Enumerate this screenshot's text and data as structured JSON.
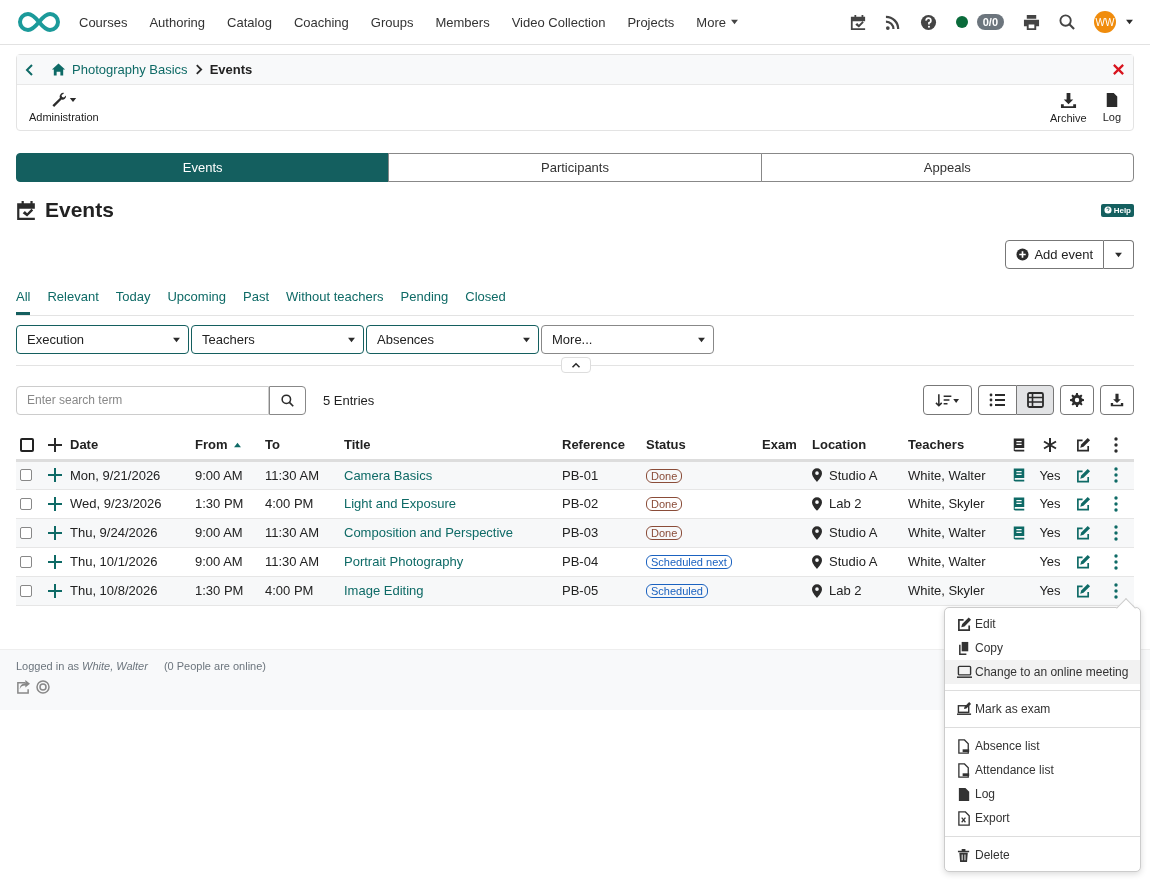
{
  "nav": {
    "items": [
      "Courses",
      "Authoring",
      "Catalog",
      "Coaching",
      "Groups",
      "Members",
      "Video Collection",
      "Projects"
    ],
    "more": "More",
    "online": true,
    "counter": "0/0",
    "avatar": "WW"
  },
  "breadcrumb": {
    "course": "Photography Basics",
    "current": "Events"
  },
  "toolbar": {
    "admin": "Administration",
    "right": [
      "Archive",
      "Log"
    ]
  },
  "segments": [
    {
      "label": "Events",
      "selected": true
    },
    {
      "label": "Participants",
      "selected": false
    },
    {
      "label": "Appeals",
      "selected": false
    }
  ],
  "page_title": "Events",
  "help": "Help",
  "add_event": "Add event",
  "filter_tabs": [
    {
      "label": "All",
      "selected": true
    },
    {
      "label": "Relevant",
      "selected": false
    },
    {
      "label": "Today",
      "selected": false
    },
    {
      "label": "Upcoming",
      "selected": false
    },
    {
      "label": "Past",
      "selected": false
    },
    {
      "label": "Without teachers",
      "selected": false
    },
    {
      "label": "Pending",
      "selected": false
    },
    {
      "label": "Closed",
      "selected": false
    }
  ],
  "filters": [
    {
      "label": "Execution",
      "kind": "filter"
    },
    {
      "label": "Teachers",
      "kind": "filter"
    },
    {
      "label": "Absences",
      "kind": "filter"
    },
    {
      "label": "More...",
      "kind": "more"
    }
  ],
  "search": {
    "placeholder": "Enter search term"
  },
  "entries": "5 Entries",
  "view_modes": [
    {
      "kind": "list",
      "selected": false
    },
    {
      "kind": "table",
      "selected": true
    }
  ],
  "table": {
    "all_checked": false,
    "columns": [
      {
        "label": "Date",
        "sorted": false
      },
      {
        "label": "From",
        "sorted": true
      },
      {
        "label": "To",
        "sorted": false
      },
      {
        "label": "Title",
        "sorted": false
      },
      {
        "label": "Reference",
        "sorted": false
      },
      {
        "label": "Status",
        "sorted": false
      },
      {
        "label": "Exam",
        "sorted": false
      },
      {
        "label": "Location",
        "sorted": false
      },
      {
        "label": "Teachers",
        "sorted": false
      }
    ],
    "rows": [
      {
        "checked": false,
        "date": "Mon, 9/21/2026",
        "from": "9:00 AM",
        "to": "11:30 AM",
        "title": "Camera Basics",
        "reference": "PB-01",
        "status": {
          "label": "Done",
          "kind": "done"
        },
        "location": "Studio A",
        "teachers": "White, Walter",
        "book": true,
        "column_12": "Yes"
      },
      {
        "checked": false,
        "date": "Wed, 9/23/2026",
        "from": "1:30 PM",
        "to": "4:00 PM",
        "title": "Light and Exposure",
        "reference": "PB-02",
        "status": {
          "label": "Done",
          "kind": "done"
        },
        "location": "Lab 2",
        "teachers": "White, Skyler",
        "book": true,
        "column_12": "Yes"
      },
      {
        "checked": false,
        "date": "Thu, 9/24/2026",
        "from": "9:00 AM",
        "to": "11:30 AM",
        "title": "Composition and Perspective",
        "reference": "PB-03",
        "status": {
          "label": "Done",
          "kind": "done"
        },
        "location": "Studio A",
        "teachers": "White, Walter",
        "book": true,
        "column_12": "Yes"
      },
      {
        "checked": false,
        "date": "Thu, 10/1/2026",
        "from": "9:00 AM",
        "to": "11:30 AM",
        "title": "Portrait Photography",
        "reference": "PB-04",
        "status": {
          "label": "Scheduled next",
          "kind": "scheduled"
        },
        "location": "Studio A",
        "teachers": "White, Walter",
        "book": false,
        "column_12": "Yes"
      },
      {
        "checked": false,
        "date": "Thu, 10/8/2026",
        "from": "1:30 PM",
        "to": "4:00 PM",
        "title": "Image Editing",
        "reference": "PB-05",
        "status": {
          "label": "Scheduled",
          "kind": "scheduled"
        },
        "location": "Lab 2",
        "teachers": "White, Skyler",
        "book": false,
        "column_12": "Yes"
      }
    ]
  },
  "menu": {
    "groups": [
      [
        {
          "label": "Edit",
          "kind": "edit",
          "highlighted": false
        },
        {
          "label": "Copy",
          "kind": "copy",
          "highlighted": false
        },
        {
          "label": "Change to an online meeting",
          "kind": "online",
          "highlighted": true
        }
      ],
      [
        {
          "label": "Mark as exam",
          "kind": "exam",
          "highlighted": false
        }
      ],
      [
        {
          "label": "Absence list",
          "kind": "pdf",
          "highlighted": false
        },
        {
          "label": "Attendance list",
          "kind": "pdf",
          "highlighted": false
        },
        {
          "label": "Log",
          "kind": "log",
          "highlighted": false
        },
        {
          "label": "Export",
          "kind": "export",
          "highlighted": false
        }
      ],
      [
        {
          "label": "Delete",
          "kind": "delete",
          "highlighted": false
        }
      ]
    ]
  },
  "footer": {
    "logged_in": "Logged in as *White, Walter*",
    "online": "(0 People are online)"
  }
}
